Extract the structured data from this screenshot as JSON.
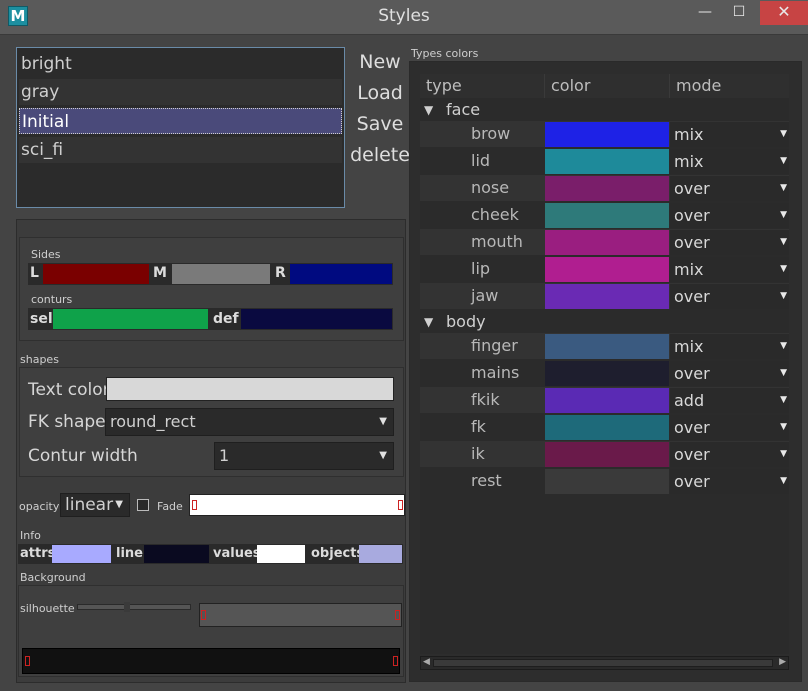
{
  "window": {
    "title": "Styles",
    "icon_letter": "M",
    "min": "—",
    "max": "☐",
    "close": "✕"
  },
  "styles": {
    "items": [
      "bright",
      "gray",
      "Initial",
      "sci_fi"
    ],
    "selected": "Initial"
  },
  "actions": {
    "new": "New",
    "load": "Load",
    "save": "Save",
    "delete": "delete"
  },
  "sides": {
    "label": "Sides",
    "l_label": "L",
    "l_color": "#7a0000",
    "m_label": "M",
    "m_color": "#7a7a7a",
    "r_label": "R",
    "r_color": "#000a80"
  },
  "conturs": {
    "label": "conturs",
    "sel_label": "sel",
    "sel_color": "#0fa24a",
    "def_label": "def",
    "def_color": "#0a0a40"
  },
  "shapes": {
    "label": "shapes",
    "text_color_label": "Text color",
    "text_color": "#d8d8d8",
    "fk_shape_label": "FK shape",
    "fk_shape_value": "round_rect",
    "contur_width_label": "Contur width",
    "contur_width_value": "1"
  },
  "opacity": {
    "label": "opacity",
    "mode": "linear",
    "fade_label": "Fade",
    "fade_checked": false
  },
  "info": {
    "label": "Info",
    "attrs_label": "attrs",
    "attrs_color": "#a8aaff",
    "line_label": "line",
    "line_color": "#0a0a20",
    "values_label": "values",
    "values_color": "#ffffff",
    "objects_label": "objects",
    "objects_color": "#a8aadf"
  },
  "background": {
    "label": "Background",
    "silhouette_label": "silhouette"
  },
  "types_colors": {
    "label": "Types colors",
    "headers": [
      "type",
      "color",
      "mode"
    ],
    "groups": [
      {
        "name": "face",
        "rows": [
          {
            "type": "brow",
            "color": "#1e22e6",
            "mode": "mix"
          },
          {
            "type": "lid",
            "color": "#1e8a9a",
            "mode": "mix"
          },
          {
            "type": "nose",
            "color": "#7a1e6a",
            "mode": "over"
          },
          {
            "type": "cheek",
            "color": "#2e7a7a",
            "mode": "over"
          },
          {
            "type": "mouth",
            "color": "#9a1e80",
            "mode": "over"
          },
          {
            "type": "lip",
            "color": "#b01e90",
            "mode": "mix"
          },
          {
            "type": "jaw",
            "color": "#6a2ab4",
            "mode": "over"
          }
        ]
      },
      {
        "name": "body",
        "rows": [
          {
            "type": "finger",
            "color": "#3a5a80",
            "mode": "mix"
          },
          {
            "type": "mains",
            "color": "#1e1e2e",
            "mode": "over"
          },
          {
            "type": "fkik",
            "color": "#5a2ab4",
            "mode": "add"
          },
          {
            "type": "fk",
            "color": "#1e6a7a",
            "mode": "over"
          },
          {
            "type": "ik",
            "color": "#6a1a4a",
            "mode": "over"
          },
          {
            "type": "rest",
            "color": "#3a3a3a",
            "mode": "over"
          }
        ]
      }
    ]
  }
}
